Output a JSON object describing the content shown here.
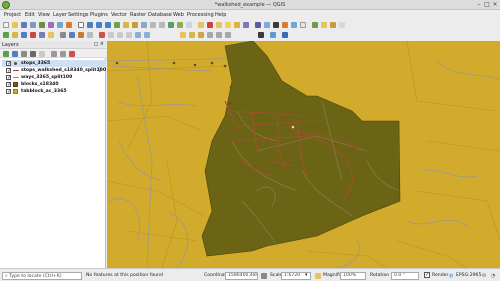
{
  "window": {
    "title": "*walkshed_example — QGIS"
  },
  "menu": [
    "Project",
    "Edit",
    "View",
    "Layer",
    "Settings",
    "Plugins",
    "Vector",
    "Raster",
    "Database",
    "Web",
    "Processing",
    "Help"
  ],
  "layers_panel": {
    "title": "Layers",
    "layers": [
      {
        "name": "stops_3365",
        "checked": true,
        "symbol": "point",
        "color": "#6b4a2a"
      },
      {
        "name": "stops_walkshed_s18340_split100",
        "checked": true,
        "symbol": "line",
        "color": "#a05030"
      },
      {
        "name": "ways_3365_split100",
        "checked": true,
        "symbol": "line",
        "color": "#8a8a8a"
      },
      {
        "name": "blocks_s18340",
        "checked": true,
        "symbol": "fill",
        "color": "#6b6414"
      },
      {
        "name": "tabblock_ac_3365",
        "checked": true,
        "symbol": "fill",
        "color": "#d2ab2d"
      }
    ]
  },
  "status": {
    "locator_placeholder": "Type to locate (Ctrl+K)",
    "message": "No features at this position found",
    "coordinate_label": "Coordinate",
    "coordinate": "1586400,484277",
    "scale_label": "Scale",
    "scale": "1:6720",
    "magnifier_label": "Magnifier",
    "magnifier": "100%",
    "rotation_label": "Rotation",
    "rotation": "0.0 °",
    "render_label": "Render",
    "crs": "EPSG:2965"
  },
  "colors": {
    "map_fill": "#d2ab2d",
    "block_fill": "#6b6414",
    "walkshed": "#a0502e",
    "roads": "#9a9a8c"
  }
}
